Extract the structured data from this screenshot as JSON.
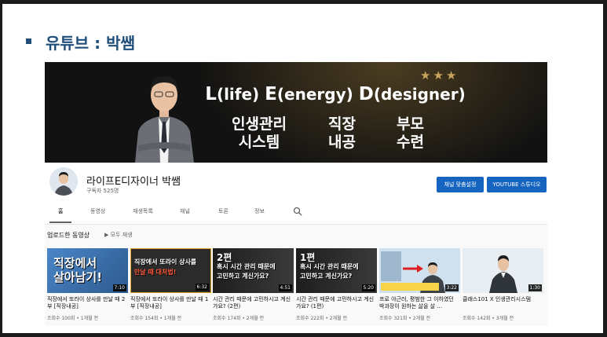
{
  "slide": {
    "title": "유튜브 : 박쌤"
  },
  "banner": {
    "brand_parts": [
      "L",
      "(life) ",
      "E",
      "(energy) ",
      "D",
      "(designer)"
    ],
    "stars": "★★★",
    "keywords": [
      {
        "line1": "인생관리",
        "line2": "시스템"
      },
      {
        "line1": "직장",
        "line2": "내공"
      },
      {
        "line1": "부모",
        "line2": "수련"
      }
    ]
  },
  "channel": {
    "name": "라이프E디자이너 박쌤",
    "subscribers": "구독자 525명",
    "customize_button": "채널 맞춤설정",
    "studio_button": "YOUTUBE 스튜디오"
  },
  "tabs": [
    "홈",
    "동영상",
    "재생목록",
    "채널",
    "토론",
    "정보"
  ],
  "active_tab": "홈",
  "section": {
    "title": "업로드한 동영상",
    "play_all": "▶ 모두 재생"
  },
  "videos": [
    {
      "title": "직장에서 또라이 상사를 만날 때 2부 [직장내공]",
      "meta": "조회수 100회 • 1개월 전",
      "duration": "7:10",
      "thumb_lines": [
        "직장에서",
        "살아남기!"
      ],
      "bg": "#3a6fb0"
    },
    {
      "title": "직장에서 또라이 상사를 만날 때 1부 [직장내공]",
      "meta": "조회수 154회 • 1개월 전",
      "duration": "6:32",
      "thumb_lines": [
        "직장에서 또라이 상사를",
        "만날 때 대처법!"
      ],
      "bg": "#2b2b2b"
    },
    {
      "title": "시간 관리 때문에 고민하시고 계신가요? (2편)",
      "meta": "조회수 174회 • 2개월 전",
      "duration": "4:51",
      "thumb_lines": [
        "2편",
        "혹시 시간 관리 때문에",
        "고민하고 계신가요?"
      ],
      "bg": "#222222"
    },
    {
      "title": "시간 관리 때문에 고민하시고 계신가요? (1편)",
      "meta": "조회수 222회 • 2개월 전",
      "duration": "5:20",
      "thumb_lines": [
        "1편",
        "혹시 시간 관리 때문에",
        "고민하고 계신가요?"
      ],
      "bg": "#222222"
    },
    {
      "title": "프로 야근러, 평범한 그 이하였던 박과장이 원하는 삶을 살 ...",
      "meta": "조회수 321회 • 2개월 전",
      "duration": "3:22",
      "thumb_lines": [],
      "bg": "#cfe0ef"
    },
    {
      "title": "클래스101 X 인생관리시스템",
      "meta": "조회수 142회 • 3개월 전",
      "duration": "1:30",
      "thumb_lines": [],
      "bg": "#e8edf2"
    }
  ],
  "colors": {
    "title_blue": "#1f4e79",
    "button_blue": "#1565c0",
    "highlight_red": "#e02020",
    "star_gold": "#c9a45c"
  }
}
